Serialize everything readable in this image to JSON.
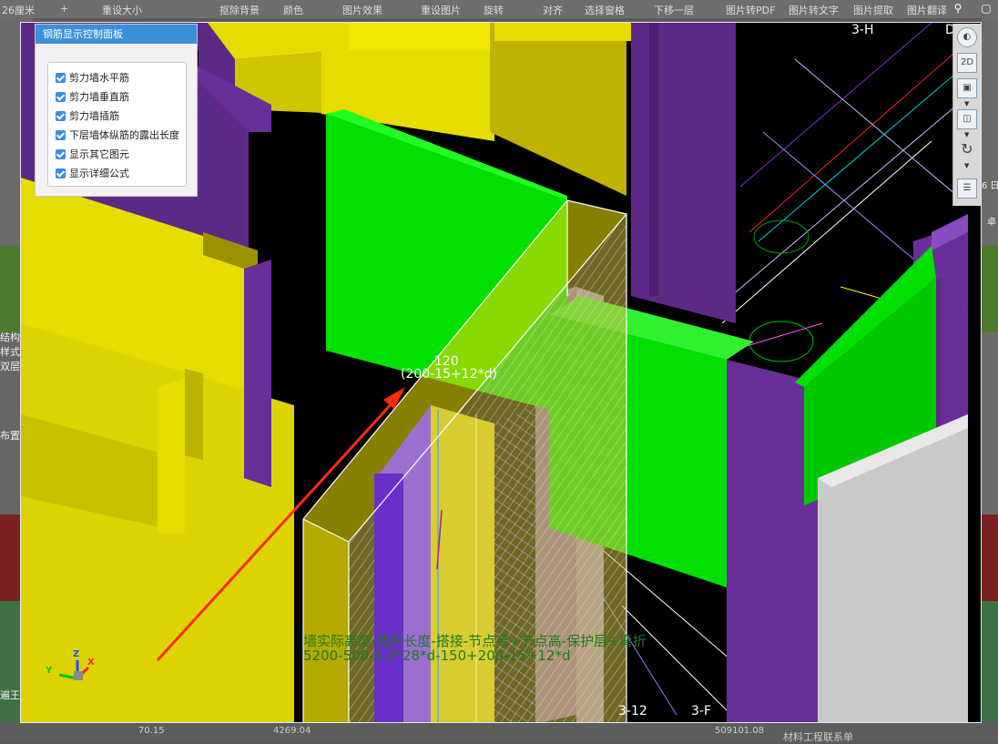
{
  "toolbar": {
    "items": [
      "26厘米",
      "重设大小",
      "抠除背景",
      "颜色",
      "图片效果",
      "重设图片",
      "旋转",
      "对齐",
      "选择窗格",
      "下移一层",
      "图片转PDF",
      "图片转文字",
      "图片提取",
      "图片翻译"
    ]
  },
  "left_fragments": [
    "结构",
    "样式",
    "双层",
    "布置(",
    "遍王"
  ],
  "right_fragments": [
    "6 日",
    "卓"
  ],
  "bottom_fragments": [
    "70.15",
    "4269.04",
    "509101.08",
    "材料工程联系单"
  ],
  "panel": {
    "title": "钢筋显示控制面板",
    "options": [
      {
        "label": "剪力墙水平筋",
        "checked": true
      },
      {
        "label": "剪力墙垂直筋",
        "checked": true
      },
      {
        "label": "剪力墙插筋",
        "checked": true
      },
      {
        "label": "下层墙体纵筋的露出长度",
        "checked": true
      },
      {
        "label": "显示其它图元",
        "checked": true
      },
      {
        "label": "显示详细公式",
        "checked": true
      }
    ]
  },
  "sidetools": {
    "scale_label": "2D"
  },
  "annotations": {
    "dim_value": "120",
    "dim_formula": "(200-15+12*d)",
    "formula_line1": "墙实际高度-错开长度-搭接-节点高+节点高-保护层+弯折",
    "formula_line2": "5200-500-1.2*28*d-150+200-15+12*d",
    "axis_3h": "3-H",
    "axis_d": "D",
    "axis_312": "3-12",
    "axis_3f": "3-F"
  },
  "axes_gizmo": {
    "x": "X",
    "y": "Y",
    "z": "Z"
  },
  "colors": {
    "wall_yellow": "#e6dc00",
    "wall_yellow_shade": "#bdb300",
    "column_purple": "#6a2e99",
    "column_purple_dark": "#4c1f70",
    "beam_green": "#00e000",
    "beam_green_dark": "#00a800",
    "arrow_red": "#ff2a10",
    "formula_green": "#1f7a1f",
    "panel_title_blue": "#3c8fd9"
  }
}
